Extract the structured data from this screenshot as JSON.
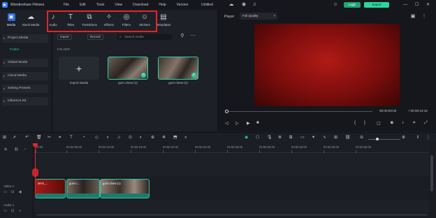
{
  "titlebar": {
    "app_title": "Wondershare Filmora",
    "menu": [
      "File",
      "Edit",
      "Tools",
      "View",
      "Download",
      "Help",
      "Version"
    ],
    "doc_title": "Untitled",
    "login_label": "Login",
    "export_label": "Export"
  },
  "tabs": [
    {
      "label": "Media",
      "icon": "media-icon",
      "glyph": "▣",
      "active": true
    },
    {
      "label": "Stock Media",
      "icon": "stock-media-icon",
      "glyph": "☁",
      "active": false
    },
    {
      "label": "Audio",
      "icon": "music-note-icon",
      "glyph": "♪",
      "active": false
    },
    {
      "label": "Titles",
      "icon": "text-t-icon",
      "glyph": "T",
      "active": false
    },
    {
      "label": "Transitions",
      "icon": "transition-icon",
      "glyph": "⧉",
      "active": false
    },
    {
      "label": "Effects",
      "icon": "effects-icon",
      "glyph": "✧",
      "active": false
    },
    {
      "label": "Filters",
      "icon": "filter-icon",
      "glyph": "◎",
      "active": false
    },
    {
      "label": "Stickers",
      "icon": "sticker-icon",
      "glyph": "☺",
      "active": false
    },
    {
      "label": "Templates",
      "icon": "template-icon",
      "glyph": "▤",
      "active": false
    }
  ],
  "sidebar": {
    "items": [
      "Project Media",
      "Global Media",
      "Cloud Media",
      "Setting Presets",
      "Influence Kit"
    ],
    "sub_item": "Folder"
  },
  "media": {
    "filters": [
      "Import",
      "Record"
    ],
    "search_placeholder": "Search media",
    "folder_label": "FOLDER",
    "import_label": "Import Media",
    "clips": [
      {
        "caption": "gum-chew-(1)"
      },
      {
        "caption": "gum-chew-(2)"
      }
    ]
  },
  "player": {
    "label": "Player",
    "quality": "Full Quality",
    "current_time": "00:00:00:00",
    "total_time": "/ 00:00:13:18"
  },
  "timeline": {
    "ruler": [
      "00:00",
      "00:00:05:00",
      "00:00:10:00",
      "00:00:15:00",
      "00:00:20:00",
      "00:00:25:00",
      "00:00:30:00",
      "00:00:35:00",
      "00:00:40:00",
      "00:00:45:00",
      "00:00:50:00"
    ],
    "tracks": [
      {
        "label": "Video 1"
      },
      {
        "label": "Audio 1"
      }
    ],
    "clips": [
      {
        "label": "MAX_...",
        "colors": [
          "#a41b17",
          "#5e0b09"
        ]
      },
      {
        "label": "gum-c...",
        "colors": [
          "#7a6a60",
          "#2a2420"
        ]
      },
      {
        "label": "gum-chew-(1)",
        "colors": [
          "#8e7f74",
          "#3a302a"
        ]
      }
    ]
  },
  "colors": {
    "accent": "#28d1a0",
    "highlight_box": "#e3242b",
    "playhead": "#e3242b"
  }
}
